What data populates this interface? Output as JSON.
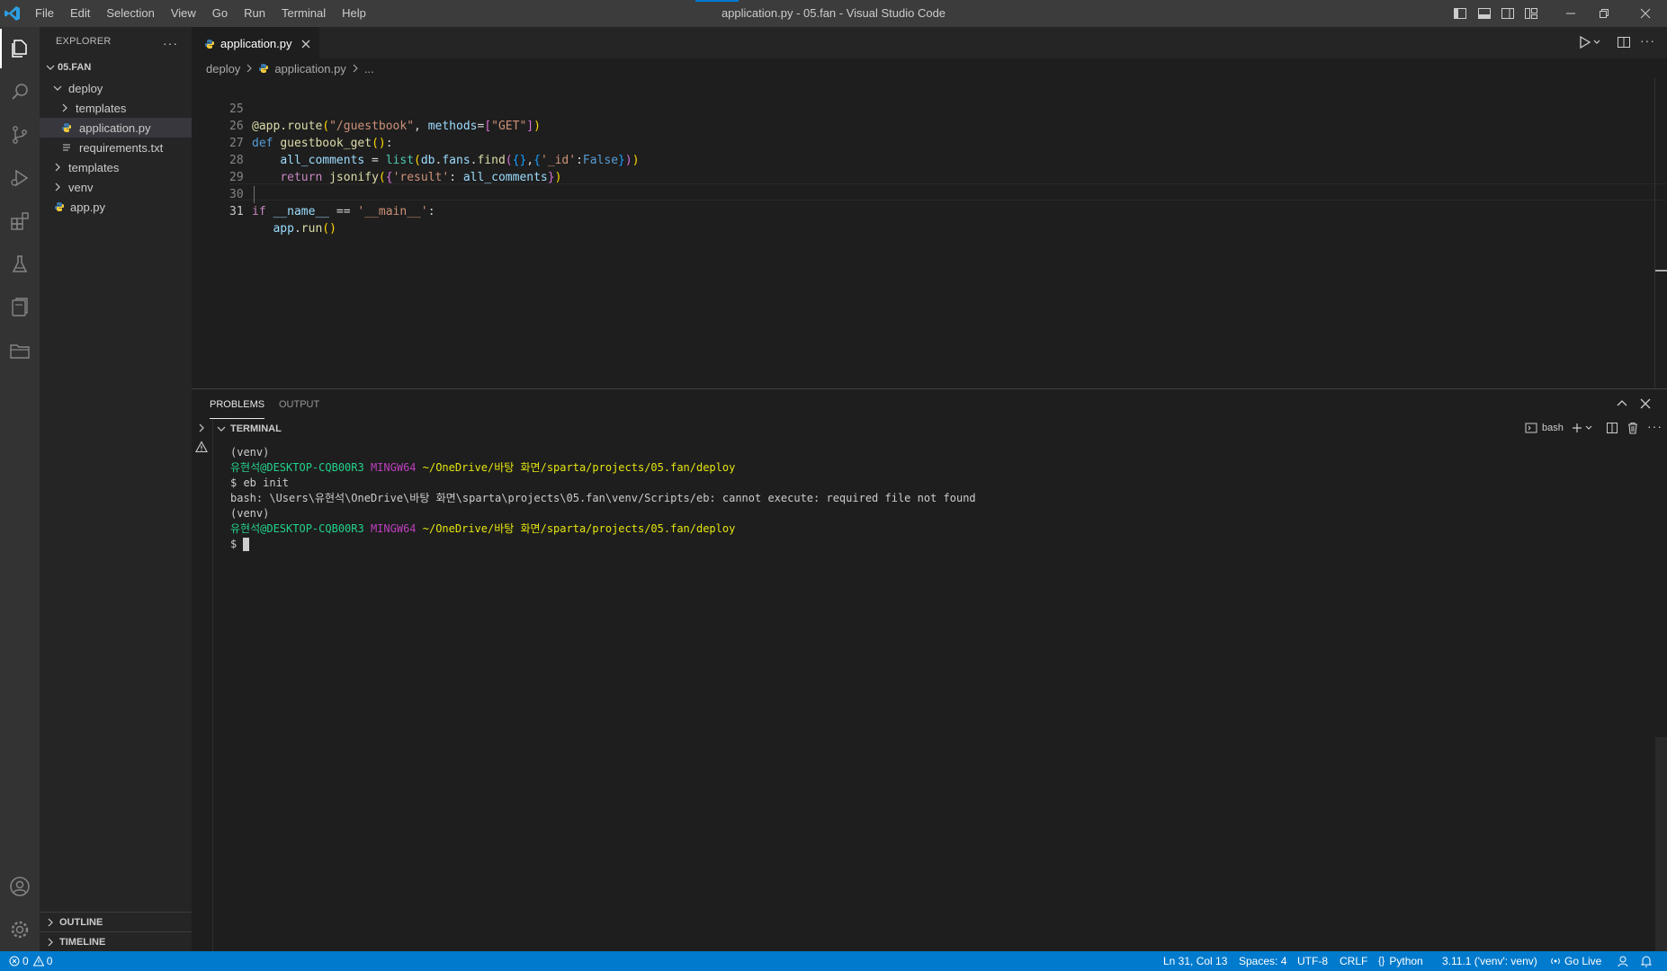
{
  "window": {
    "title": "application.py - 05.fan - Visual Studio Code",
    "menu": [
      "File",
      "Edit",
      "Selection",
      "View",
      "Go",
      "Run",
      "Terminal",
      "Help"
    ]
  },
  "sidebar": {
    "title": "EXPLORER",
    "root": "05.FAN",
    "tree": [
      {
        "label": "deploy",
        "kind": "folder-open"
      },
      {
        "label": "templates",
        "kind": "folder-closed"
      },
      {
        "label": "application.py",
        "kind": "python-file",
        "selected": true
      },
      {
        "label": "requirements.txt",
        "kind": "text-file"
      },
      {
        "label": "templates",
        "kind": "folder-closed"
      },
      {
        "label": "venv",
        "kind": "folder-closed"
      },
      {
        "label": "app.py",
        "kind": "python-file"
      }
    ],
    "outline": "OUTLINE",
    "timeline": "TIMELINE"
  },
  "editor": {
    "tab_label": "application.py",
    "breadcrumbs": [
      "deploy",
      "application.py",
      "..."
    ],
    "line_numbers": [
      "25",
      "26",
      "27",
      "28",
      "29",
      "30",
      "31"
    ]
  },
  "panel": {
    "tabs": [
      "PROBLEMS",
      "OUTPUT"
    ],
    "terminal_title": "TERMINAL",
    "shell": "bash",
    "lines": [
      {
        "text": "(venv)"
      },
      {
        "user": "유현석@DESKTOP-CQB00R3",
        "env": " MINGW64",
        "path": " ~/OneDrive/바탕 화면/sparta/projects/05.fan/deploy"
      },
      {
        "text": "$ eb init"
      },
      {
        "text": "bash: \\Users\\유현석\\OneDrive\\바탕 화면\\sparta\\projects\\05.fan\\venv/Scripts/eb: cannot execute: required file not found"
      },
      {
        "text": "(venv)"
      },
      {
        "user": "유현석@DESKTOP-CQB00R3",
        "env": " MINGW64",
        "path": " ~/OneDrive/바탕 화면/sparta/projects/05.fan/deploy"
      },
      {
        "text": "$ "
      }
    ]
  },
  "statusbar": {
    "errors": "0",
    "warnings": "0",
    "position": "Ln 31, Col 13",
    "spaces": "Spaces: 4",
    "encoding": "UTF-8",
    "eol": "CRLF",
    "language": "Python",
    "interpreter": "3.11.1 ('venv': venv)",
    "golive": "Go Live"
  },
  "colors": {
    "accent": "#007acc",
    "keyword": "#c586c0",
    "function": "#dcdcaa",
    "string": "#ce9178",
    "variable": "#9cdcfe",
    "terminal_user": "#23d18b",
    "terminal_env": "#bc3fbc",
    "terminal_path": "#e5e510"
  }
}
